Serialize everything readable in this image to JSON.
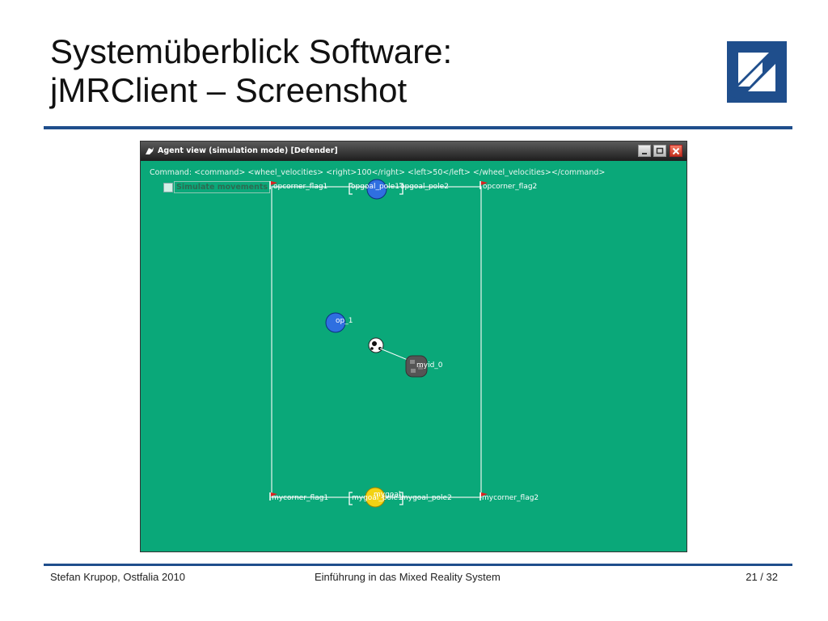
{
  "slide": {
    "title_line1": "Systemüberblick Software:",
    "title_line2": "jMRClient – Screenshot",
    "footer_left": "Stefan Krupop, Ostfalia 2010",
    "footer_center": "Einführung in das Mixed Reality System",
    "footer_right": "21 / 32",
    "logo_icon": "ostfalia-logo-icon",
    "accent_color": "#1f4e8c"
  },
  "window": {
    "title": "Agent view (simulation mode) [Defender]",
    "command": "Command: <command>  <wheel_velocities>    <right>100</right>    <left>50</left>  </wheel_velocities></command>",
    "simulate_label": "Simulate movements",
    "simulate_checked": false,
    "background_color": "#0aa879",
    "buttons": [
      "minimize-icon",
      "maximize-icon",
      "close-icon"
    ]
  },
  "field": {
    "flags": {
      "top_left": "opcorner_flag1",
      "top_right": "opcorner_flag2",
      "bottom_left": "mycorner_flag1",
      "bottom_right": "mycorner_flag2"
    },
    "goals": {
      "top_pole1": "opgoal_pole1",
      "top_pole2": "opgoal_pole2",
      "bottom_pole1": "mygoal_pole1",
      "bottom_pole2": "mygoal_pole2"
    },
    "agents": {
      "op_keeper": "",
      "op_1": "op_1",
      "my_0": "myid_0",
      "my_keeper": "mygoal"
    },
    "ball_icon": "soccer-ball-icon",
    "colors": {
      "opponent": "#2f6fe0",
      "own_keeper": "#f2d214",
      "flag": "#e02020",
      "line": "#e8f4ee"
    }
  }
}
